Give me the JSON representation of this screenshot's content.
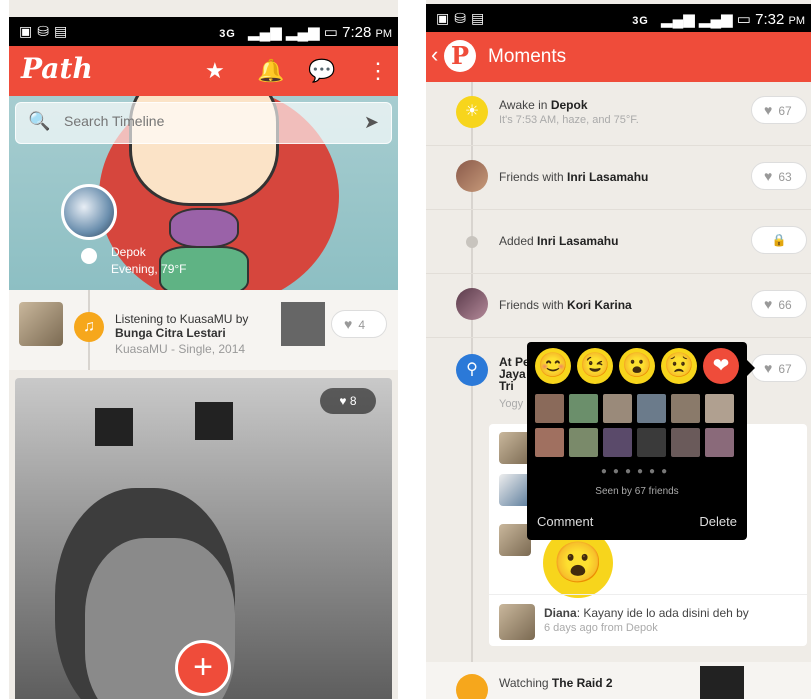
{
  "left": {
    "status_time": "7:28",
    "status_ampm": "PM",
    "status_net": "3G",
    "app_logo": "Path",
    "search_placeholder": "Search Timeline",
    "cover_location": "Depok",
    "cover_weather": "Evening, 79°F",
    "music": {
      "line1": "Listening to KuasaMU by",
      "artist": "Bunga Citra Lestari",
      "sub": "KuasaMU - Single, 2014",
      "likes": "4"
    },
    "photo_likes": "8",
    "fab_label": "+"
  },
  "right": {
    "status_time": "7:32",
    "status_ampm": "PM",
    "status_net": "3G",
    "title": "Moments",
    "rows": [
      {
        "prefix": "Awake in ",
        "bold": "Depok",
        "sub": "It's 7:53 AM, haze, and 75°F.",
        "likes": "67"
      },
      {
        "prefix": "Friends with ",
        "bold": "Inri Lasamahu",
        "sub": "",
        "likes": "63"
      },
      {
        "prefix": "Added ",
        "bold": "Inri Lasamahu",
        "sub": "",
        "likes": ""
      },
      {
        "prefix": "Friends with ",
        "bold": "Kori Karina",
        "sub": "",
        "likes": "66"
      }
    ],
    "checkin": {
      "l1": "At Pe",
      "l2": "Jaya",
      "l3": "Tri",
      "sub": "Yogy",
      "likes": "67"
    },
    "popup": {
      "emojis": [
        "😊",
        "😉",
        "😮",
        "😟",
        "❤"
      ],
      "seen": "Seen by 67 friends",
      "comment": "Comment",
      "delete": "Delete"
    },
    "comment": {
      "author": "Diana",
      "text": ": Kayany ide lo ada disini deh by",
      "meta": "6 days ago from Depok"
    },
    "bottom_prefix": "Watching ",
    "bottom_bold": "The Raid 2"
  },
  "colors": {
    "brand": "#ef4c3a",
    "emoji": "#f7d51c",
    "music": "#f6a71c",
    "place": "#2b79d8"
  }
}
